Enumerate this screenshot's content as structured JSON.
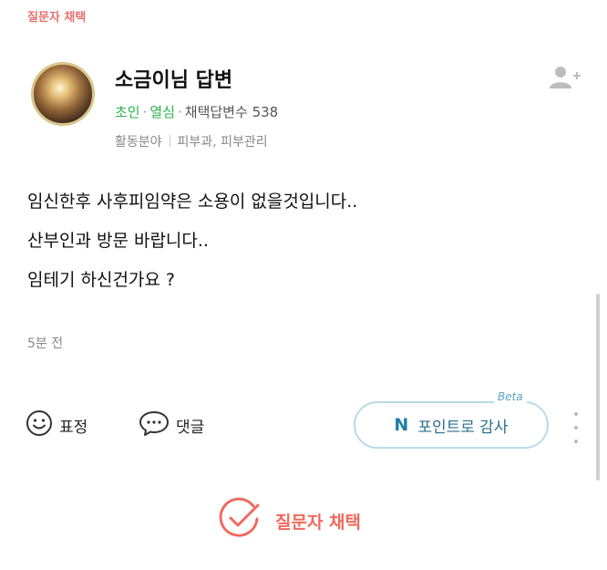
{
  "header": {
    "top_label": "질문자 채택"
  },
  "author": {
    "name": "소금이님 답변",
    "rank": "초인",
    "badge": "열심",
    "adopted_label": "채택답변수",
    "adopted_count": "538",
    "field_label": "활동분야",
    "field_value": "피부과, 피부관리"
  },
  "answer": {
    "lines": [
      "임신한후 사후피임약은 소용이 없을것입니다..",
      "산부인과 방문 바랍니다..",
      "임테기 하신건가요 ?"
    ],
    "time": "5분 전"
  },
  "actions": {
    "emoji_label": "표정",
    "comment_label": "댓글",
    "point_logo": "N",
    "point_label": "포인트로 감사",
    "beta_label": "Beta"
  },
  "choose": {
    "label": "질문자 채택"
  },
  "colors": {
    "accent_red": "#ef6a5e",
    "green": "#2bb24c",
    "point_border": "#b9dbe8",
    "point_text": "#2a6f8c"
  },
  "icons": {
    "add_user": "add-user-icon",
    "emoji": "smile-icon",
    "comment": "speech-bubble-icon",
    "more": "more-vertical-icon",
    "check": "check-circle-icon"
  }
}
